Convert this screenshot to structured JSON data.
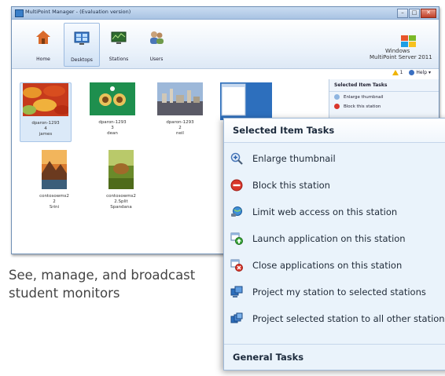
{
  "window": {
    "title": "MultiPoint Manager - (Evaluation version)",
    "minimize_icon": "minimize-icon",
    "maximize_icon": "maximize-icon",
    "close_icon": "close-icon"
  },
  "nav": {
    "items": [
      {
        "label": "Home",
        "icon": "home-icon"
      },
      {
        "label": "Desktops",
        "icon": "desktops-icon"
      },
      {
        "label": "Stations",
        "icon": "stations-icon"
      },
      {
        "label": "Users",
        "icon": "users-icon"
      }
    ],
    "active": "Desktops"
  },
  "brand": {
    "line1": "Windows",
    "line2": "MultiPoint Server 2011"
  },
  "toolbar": {
    "alert_count": "1",
    "help_label": "Help"
  },
  "thumbnails": [
    {
      "lines": [
        "dparon-1293",
        "4",
        "james"
      ],
      "selected": true
    },
    {
      "lines": [
        "dparon-1293",
        "3",
        "dean"
      ],
      "selected": false
    },
    {
      "lines": [
        "dparon-1293",
        "2",
        "neil"
      ],
      "selected": false
    },
    {
      "lines": [
        "contosowms2",
        "2",
        "Srini"
      ],
      "selected": false
    },
    {
      "lines": [
        "contosowms2",
        "2.Split",
        "Spandana"
      ],
      "selected": false
    }
  ],
  "task_panel": {
    "header": "Selected Item Tasks",
    "rows": [
      "Enlarge thumbnail",
      "Block this station"
    ]
  },
  "zoom_panel": {
    "header": "Selected Item Tasks",
    "tasks": [
      {
        "label": "Enlarge thumbnail",
        "icon": "magnifier-plus-icon"
      },
      {
        "label": "Block this station",
        "icon": "block-icon"
      },
      {
        "label": "Limit web access on this station",
        "icon": "web-limit-icon"
      },
      {
        "label": "Launch application on this station",
        "icon": "launch-app-icon"
      },
      {
        "label": "Close applications on this station",
        "icon": "close-app-icon"
      },
      {
        "label": "Project my station to selected stations",
        "icon": "project-icon"
      },
      {
        "label": "Project selected station to all other stations",
        "icon": "project-all-icon"
      }
    ],
    "footer": "General Tasks"
  },
  "caption": "See, manage, and broadcast student monitors",
  "colors": {
    "accent": "#3a7fc9",
    "panel_bg": "#eaf3fb",
    "close_red": "#c0412a"
  }
}
